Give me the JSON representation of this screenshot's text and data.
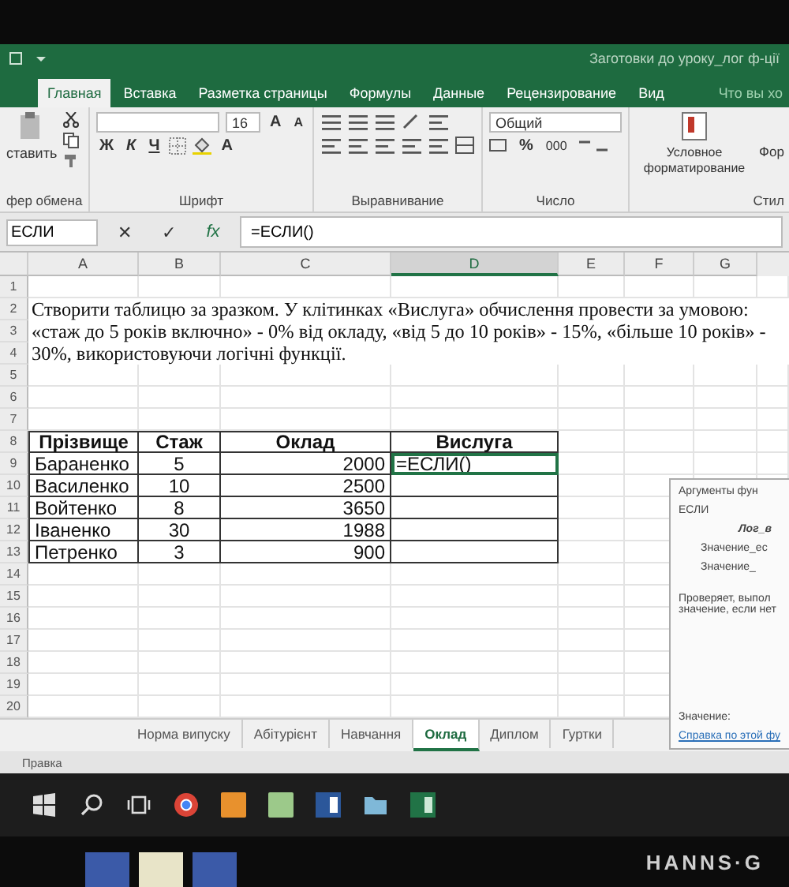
{
  "window": {
    "title": "Заготовки до уроку_лог ф-ції"
  },
  "ribbon_tabs": [
    {
      "label": "Главная",
      "selected": true
    },
    {
      "label": "Вставка",
      "selected": false
    },
    {
      "label": "Разметка страницы",
      "selected": false
    },
    {
      "label": "Формулы",
      "selected": false
    },
    {
      "label": "Данные",
      "selected": false
    },
    {
      "label": "Рецензирование",
      "selected": false
    },
    {
      "label": "Вид",
      "selected": false
    }
  ],
  "tell_me": {
    "placeholder": "Что вы хо"
  },
  "ribbon": {
    "paste_label": "ставить",
    "clipboard_group": "фер обмена",
    "font_size": "16",
    "grow_font": "A",
    "shrink_font": "A",
    "style_buttons": [
      "Ж",
      "К",
      "Ч"
    ],
    "font_color": "A",
    "font_group": "Шрифт",
    "alignment_group": "Выравнивание",
    "number_format": "Общий",
    "percent": "%",
    "thousands": "000",
    "number_group": "Число",
    "conditional_formatting": "Условное форматирование",
    "format_table": "Фор",
    "styles_group": "Стил"
  },
  "formula_bar": {
    "name_box": "ЕСЛИ",
    "cancel": "✕",
    "enter": "✓",
    "function": "fx",
    "formula": "=ЕСЛИ()"
  },
  "columns": [
    {
      "label": "A",
      "selected": false
    },
    {
      "label": "B",
      "selected": false
    },
    {
      "label": "C",
      "selected": false
    },
    {
      "label": "D",
      "selected": true
    },
    {
      "label": "E",
      "selected": false
    },
    {
      "label": "F",
      "selected": false
    },
    {
      "label": "G",
      "selected": false
    }
  ],
  "row_numbers": [
    "1",
    "2",
    "3",
    "4",
    "5",
    "6",
    "7",
    "8",
    "9",
    "10",
    "11",
    "12",
    "13",
    "14",
    "15",
    "16",
    "17",
    "18",
    "19",
    "20"
  ],
  "instruction": "Створити таблицю за зразком. У клітинках «Вислуга» обчислення провести за умовою: «стаж до 5 років включно» - 0% від окладу, «від 5 до 10 років» - 15%, «більше 10 років» - 30%, використовуючи логічні функції.",
  "table": {
    "headers": [
      "Прізвище",
      "Стаж",
      "Оклад",
      "Вислуга"
    ],
    "rows": [
      {
        "surname": "Бараненко",
        "experience": "5",
        "salary": "2000",
        "bonus": "=ЕСЛИ()",
        "selected": true
      },
      {
        "surname": "Василенко",
        "experience": "10",
        "salary": "2500",
        "selected": false
      },
      {
        "surname": "Войтенко",
        "experience": "8",
        "salary": "3650",
        "selected": false
      },
      {
        "surname": "Іваненко",
        "experience": "30",
        "salary": "1988",
        "selected": false
      },
      {
        "surname": "Петренко",
        "experience": "3",
        "salary": "900",
        "selected": false
      }
    ]
  },
  "function_dialog": {
    "title": "Аргументы фун",
    "function": "ЕСЛИ",
    "arguments": [
      "Лог_в",
      "Значение_ес",
      "Значение_"
    ],
    "description": [
      "Проверяет, выпол",
      "значение, если нет"
    ],
    "result_label": "Значение:",
    "help_link": "Справка по этой фу"
  },
  "sheet_tabs": [
    {
      "label": "Норма випуску",
      "selected": false
    },
    {
      "label": "Абітурієнт",
      "selected": false
    },
    {
      "label": "Навчання",
      "selected": false
    },
    {
      "label": "Оклад",
      "selected": true
    },
    {
      "label": "Диплом",
      "selected": false
    },
    {
      "label": "Гуртки",
      "selected": false
    }
  ],
  "status_bar": "Правка",
  "taskbar": [
    {
      "kind": "start"
    },
    {
      "kind": "search"
    },
    {
      "kind": "taskview"
    },
    {
      "kind": "browser",
      "color": "#db4437"
    },
    {
      "kind": "app",
      "color": "#e8912d"
    },
    {
      "kind": "app",
      "color": "#9cc98a"
    },
    {
      "kind": "word",
      "color": "#2b579a"
    },
    {
      "kind": "folder",
      "color": "#7fb8d8"
    },
    {
      "kind": "excel",
      "color": "#217346"
    }
  ],
  "monitor_brand": "HANNS·G"
}
